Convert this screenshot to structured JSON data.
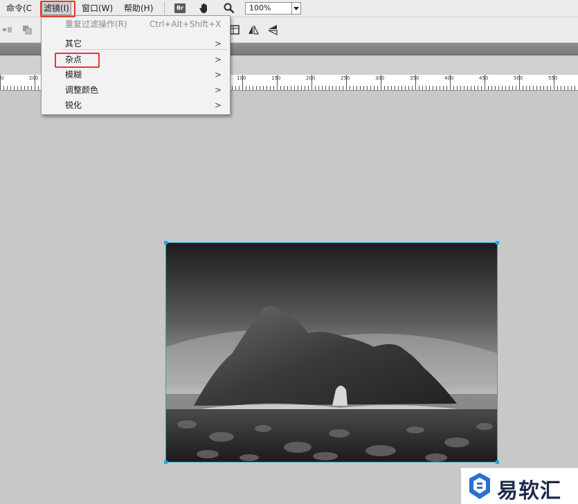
{
  "menubar": {
    "command": "命令(C",
    "filter": "滤镜(I)",
    "window": "窗口(W)",
    "help": "帮助(H)",
    "bridge": "Br",
    "zoom_value": "100%"
  },
  "filter_menu": {
    "repeat": "重复过滤操作(R)",
    "repeat_shortcut": "Ctrl+Alt+Shift+X",
    "items": [
      {
        "label": "其它",
        "arrow": ">"
      },
      {
        "label": "杂点",
        "arrow": ">"
      },
      {
        "label": "模糊",
        "arrow": ">"
      },
      {
        "label": "调整颜色",
        "arrow": ">"
      },
      {
        "label": "锐化",
        "arrow": ">"
      }
    ]
  },
  "ruler": {
    "labels": [
      "0",
      "200",
      "100",
      "150",
      "200",
      "250",
      "300",
      "350",
      "400",
      "450",
      "500",
      "550"
    ]
  },
  "watermark": {
    "text": "易软汇"
  },
  "colors": {
    "accent": "#27a3e0",
    "highlight": "#e03a2f"
  }
}
